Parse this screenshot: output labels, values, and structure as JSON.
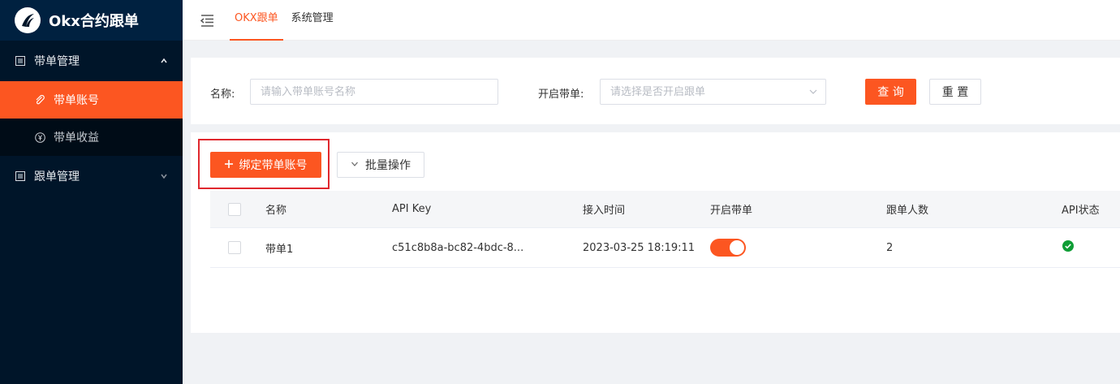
{
  "app": {
    "title": "Okx合约跟单"
  },
  "sidebar": {
    "groups": [
      {
        "label": "带单管理",
        "icon": "list-icon",
        "expanded": true,
        "items": [
          {
            "label": "带单账号",
            "icon": "link-icon",
            "active": true
          },
          {
            "label": "带单收益",
            "icon": "yen-icon",
            "active": false
          }
        ]
      },
      {
        "label": "跟单管理",
        "icon": "list-icon",
        "expanded": false
      }
    ]
  },
  "header": {
    "tabs": [
      {
        "label": "OKX跟单",
        "active": true
      },
      {
        "label": "系统管理",
        "active": false
      }
    ]
  },
  "search": {
    "name_label": "名称:",
    "name_placeholder": "请输入带单账号名称",
    "enable_label": "开启带单:",
    "enable_placeholder": "请选择是否开启跟单",
    "query_button": "查 询",
    "reset_button": "重 置"
  },
  "toolbar": {
    "bind_button": "绑定带单账号",
    "batch_button": "批量操作"
  },
  "table": {
    "columns": [
      "名称",
      "API Key",
      "接入时间",
      "开启带单",
      "跟单人数",
      "API状态"
    ],
    "rows": [
      {
        "name": "带单1",
        "api_key": "c51c8b8a-bc82-4bdc-8...",
        "time": "2023-03-25 18:19:11",
        "enabled": true,
        "followers": "2",
        "api_status": "ok"
      }
    ]
  },
  "colors": {
    "accent": "#fc5621",
    "sidebar_bg": "#001529",
    "success": "#0f9d35",
    "highlight": "#e0282e"
  }
}
